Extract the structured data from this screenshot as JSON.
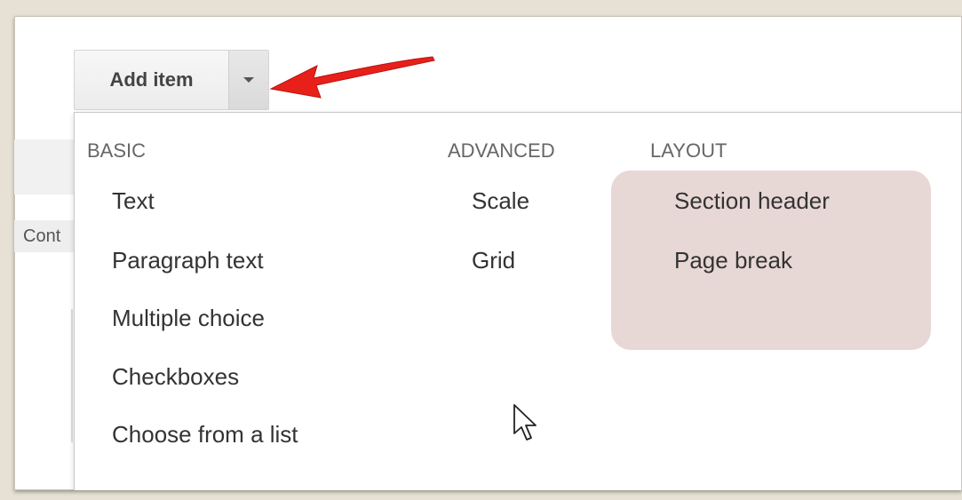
{
  "toolbar": {
    "add_item_label": "Add item"
  },
  "background": {
    "partial_label": "Cont"
  },
  "menu": {
    "columns": [
      {
        "header": "BASIC",
        "items": [
          "Text",
          "Paragraph text",
          "Multiple choice",
          "Checkboxes",
          "Choose from a list"
        ]
      },
      {
        "header": "ADVANCED",
        "items": [
          "Scale",
          "Grid"
        ]
      },
      {
        "header": "LAYOUT",
        "items": [
          "Section header",
          "Page break"
        ]
      }
    ]
  },
  "colors": {
    "arrow": "#e8201a",
    "layout_highlight": "#e8d8d5"
  }
}
